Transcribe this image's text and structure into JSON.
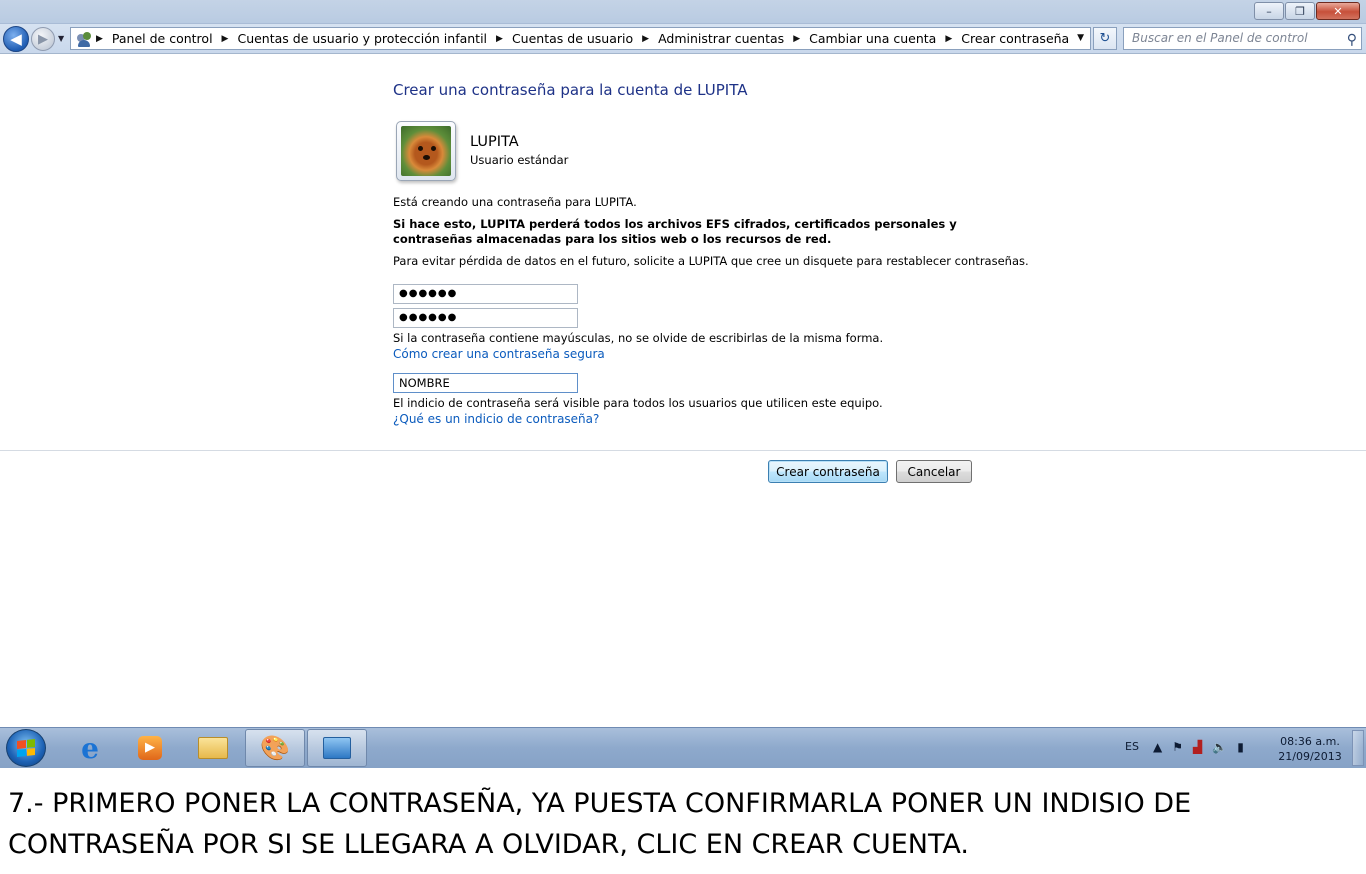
{
  "window": {
    "controls": {
      "minimize": "–",
      "maximize": "❐",
      "close": "✕"
    }
  },
  "navbar": {
    "back_icon": "back-arrow-icon",
    "forward_icon": "forward-arrow-icon",
    "breadcrumbs": [
      "Panel de control",
      "Cuentas de usuario y protección infantil",
      "Cuentas de usuario",
      "Administrar cuentas",
      "Cambiar una cuenta",
      "Crear contraseña"
    ],
    "search_placeholder": "Buscar en el Panel de control"
  },
  "main": {
    "heading": "Crear una contraseña para la cuenta de LUPITA",
    "account": {
      "name": "LUPITA",
      "role": "Usuario estándar"
    },
    "info_line": "Está creando una contraseña para LUPITA.",
    "warning": "Si hace esto, LUPITA perderá todos los archivos EFS cifrados, certificados personales y contraseñas almacenadas para los sitios web o los recursos de red.",
    "advice": "Para evitar pérdida de datos en el futuro, solicite a LUPITA que cree un disquete para restablecer contraseñas.",
    "password_value": "●●●●●●",
    "confirm_value": "●●●●●●",
    "case_note": "Si la contraseña contiene mayúsculas, no se olvide de escribirlas de la misma forma.",
    "secure_link": "Cómo crear una contraseña segura",
    "hint_value": "NOMBRE",
    "hint_note": "El indicio de contraseña será visible para todos los usuarios que utilicen este equipo.",
    "hint_link": "¿Qué es un indicio de contraseña?",
    "create_button": "Crear contraseña",
    "cancel_button": "Cancelar"
  },
  "taskbar": {
    "language": "ES",
    "time": "08:36 a.m.",
    "date": "21/09/2013"
  },
  "caption": "7.- PRIMERO PONER LA CONTRASEÑA, YA PUESTA CONFIRMARLA PONER UN INDISIO DE CONTRASEÑA POR SI SE LLEGARA A OLVIDAR, CLIC EN CREAR CUENTA."
}
